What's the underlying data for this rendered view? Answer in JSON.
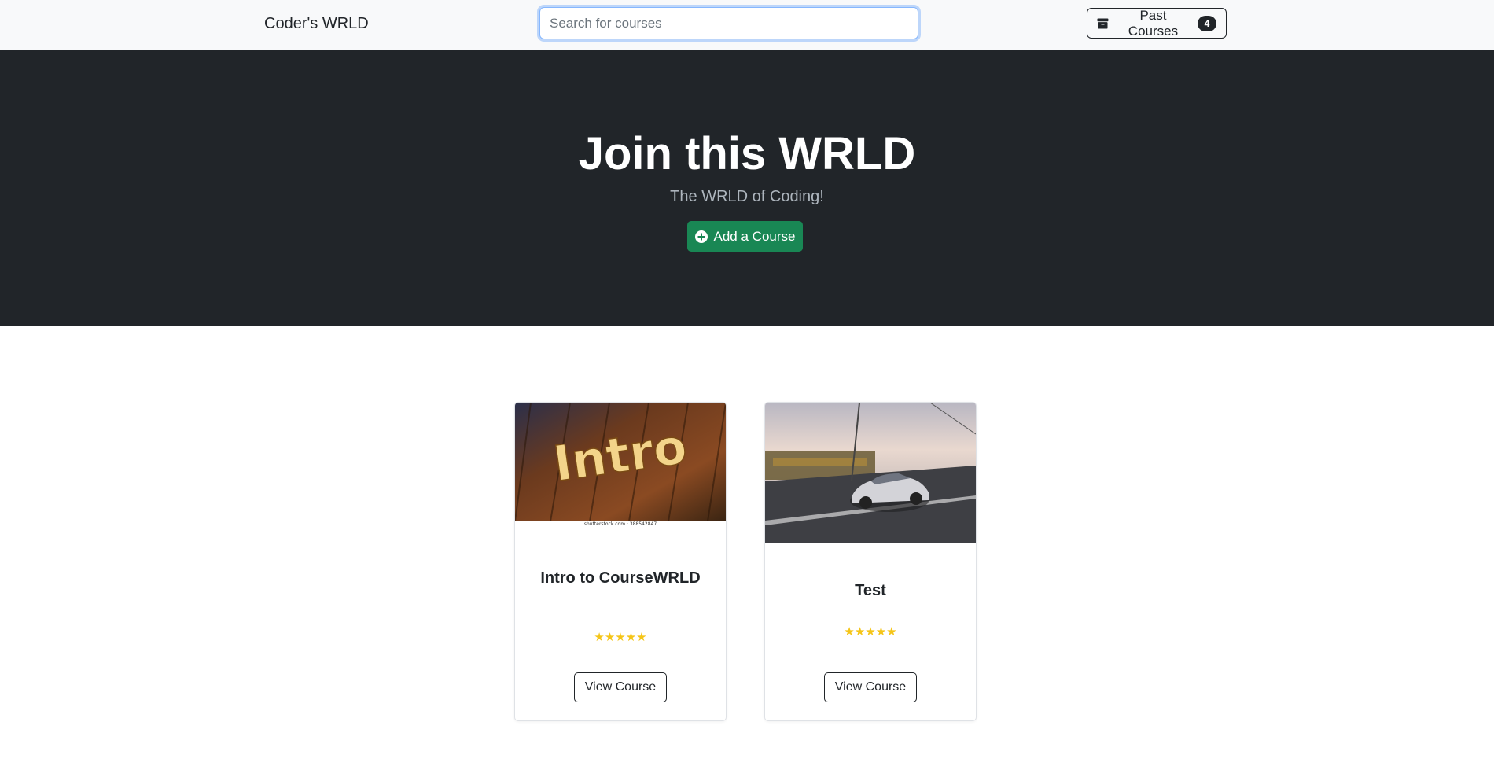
{
  "navbar": {
    "brand": "Coder's WRLD",
    "search_placeholder": "Search for courses",
    "search_value": "",
    "past_courses_label": "Past Courses",
    "past_courses_count": "4"
  },
  "hero": {
    "title": "Join this WRLD",
    "subtitle": "The WRLD of Coding!",
    "add_button_label": "Add a Course"
  },
  "courses": [
    {
      "title": "Intro to CourseWRLD",
      "image_text": "Intro",
      "image_caption": "shutterstock.com · 388542847",
      "stars": "★★★★★",
      "button_label": "View Course"
    },
    {
      "title": "Test",
      "stars": "★★★★★",
      "button_label": "View Course"
    }
  ],
  "colors": {
    "hero_bg": "#212529",
    "success": "#198754",
    "star": "#f5c518"
  },
  "icons": {
    "past_courses": "archive-box-icon",
    "add_course": "plus-circle-icon"
  }
}
